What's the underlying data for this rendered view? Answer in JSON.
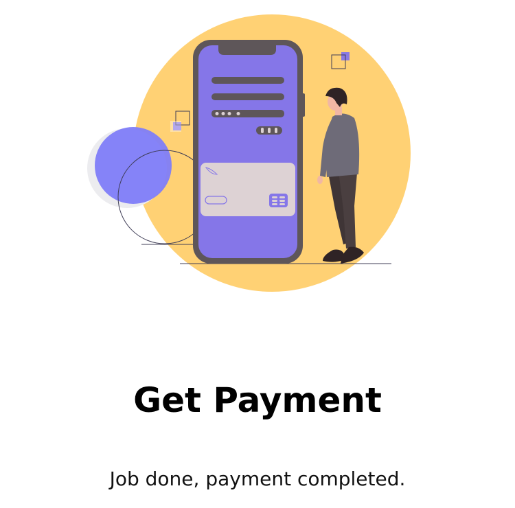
{
  "screen": {
    "title": "Get Payment",
    "subtitle": "Job done, payment completed."
  },
  "illustration": {
    "subject": "person standing beside a phone showing a payment card",
    "colors": {
      "backdrop_circle": "#ffd174",
      "accent_purple": "#8576e8",
      "blue_circle": "#7f7df8",
      "phone_frame": "#5e5659",
      "card": "#ddd2d4",
      "shirt": "#6e6b78",
      "pants": "#4a3f40",
      "skin": "#f1b7a4",
      "hair": "#2f2325"
    }
  }
}
